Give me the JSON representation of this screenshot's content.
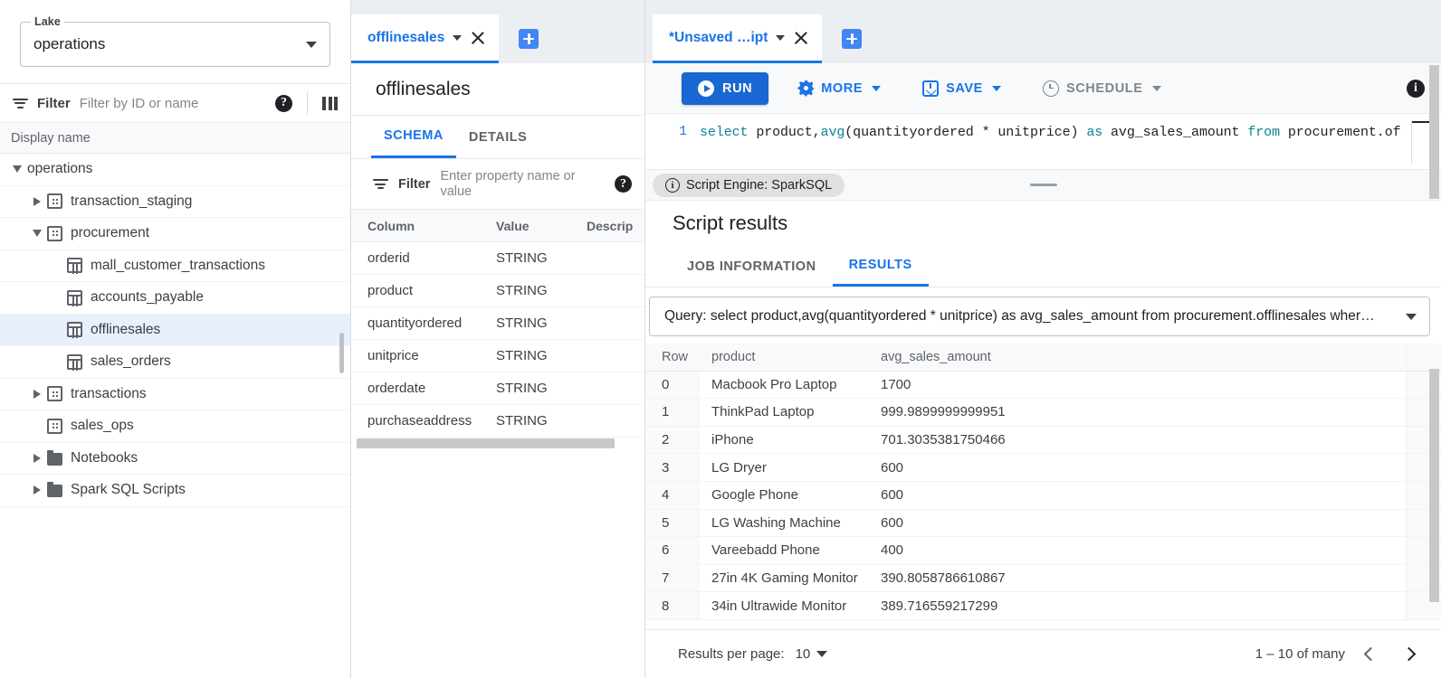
{
  "left_panel": {
    "lake_selector": {
      "legend": "Lake",
      "value": "operations",
      "icon": "chevron-down-icon"
    },
    "filter": {
      "label": "Filter",
      "placeholder": "Filter by ID or name",
      "help_icon": "help-icon",
      "columns_icon": "columns-icon"
    },
    "list_header": "Display name",
    "tree": [
      {
        "label": "operations",
        "depth": 0,
        "twisty": "open",
        "icon": "none",
        "selected": false
      },
      {
        "label": "transaction_staging",
        "depth": 1,
        "twisty": "closed",
        "icon": "database",
        "selected": false
      },
      {
        "label": "procurement",
        "depth": 1,
        "twisty": "open",
        "icon": "database",
        "selected": false
      },
      {
        "label": "mall_customer_transactions",
        "depth": 2,
        "twisty": "none",
        "icon": "table",
        "selected": false
      },
      {
        "label": "accounts_payable",
        "depth": 2,
        "twisty": "none",
        "icon": "table",
        "selected": false
      },
      {
        "label": "offlinesales",
        "depth": 2,
        "twisty": "none",
        "icon": "table",
        "selected": true
      },
      {
        "label": "sales_orders",
        "depth": 2,
        "twisty": "none",
        "icon": "table",
        "selected": false
      },
      {
        "label": "transactions",
        "depth": 1,
        "twisty": "closed",
        "icon": "database",
        "selected": false
      },
      {
        "label": "sales_ops",
        "depth": 1,
        "twisty": "none",
        "icon": "database",
        "selected": false
      },
      {
        "label": "Notebooks",
        "depth": 1,
        "twisty": "closed",
        "icon": "folder",
        "selected": false
      },
      {
        "label": "Spark SQL Scripts",
        "depth": 1,
        "twisty": "closed",
        "icon": "folder",
        "selected": false
      }
    ]
  },
  "mid_panel": {
    "tab": {
      "label": "offlinesales",
      "caret_icon": "chevron-down-icon",
      "close_icon": "close-icon"
    },
    "add_tab_icon": "plus-icon",
    "title": "offlinesales",
    "subtabs": [
      {
        "label": "SCHEMA",
        "active": true
      },
      {
        "label": "DETAILS",
        "active": false
      }
    ],
    "property_filter": {
      "label": "Filter",
      "placeholder": "Enter property name or value",
      "help_icon": "help-icon"
    },
    "schema_columns": [
      "Column",
      "Value",
      "Descrip"
    ],
    "schema_rows": [
      {
        "column": "orderid",
        "value": "STRING",
        "description": ""
      },
      {
        "column": "product",
        "value": "STRING",
        "description": ""
      },
      {
        "column": "quantityordered",
        "value": "STRING",
        "description": ""
      },
      {
        "column": "unitprice",
        "value": "STRING",
        "description": ""
      },
      {
        "column": "orderdate",
        "value": "STRING",
        "description": ""
      },
      {
        "column": "purchaseaddress",
        "value": "STRING",
        "description": ""
      }
    ]
  },
  "right_panel": {
    "tab": {
      "label": "*Unsaved …ipt",
      "caret_icon": "chevron-down-icon",
      "close_icon": "close-icon"
    },
    "add_tab_icon": "plus-icon",
    "toolbar": {
      "run_label": "RUN",
      "more_label": "MORE",
      "save_label": "SAVE",
      "schedule_label": "SCHEDULE",
      "info_icon": "info-icon"
    },
    "editor": {
      "line_number": "1",
      "code_parts": [
        {
          "text": "select",
          "kind": "keyword"
        },
        {
          "text": " product,",
          "kind": "plain"
        },
        {
          "text": "avg",
          "kind": "keyword"
        },
        {
          "text": "(quantityordered * unitprice) ",
          "kind": "plain"
        },
        {
          "text": "as",
          "kind": "keyword"
        },
        {
          "text": " avg_sales_amount ",
          "kind": "plain"
        },
        {
          "text": "from",
          "kind": "keyword"
        },
        {
          "text": " procurement.of",
          "kind": "plain"
        }
      ]
    },
    "engine_chip": {
      "label": "Script Engine: SparkSQL",
      "icon": "info-icon"
    },
    "results_title": "Script results",
    "results_tabs": [
      {
        "label": "JOB INFORMATION",
        "active": false
      },
      {
        "label": "RESULTS",
        "active": true
      }
    ],
    "query_select": {
      "text": "Query: select product,avg(quantityordered * unitprice) as avg_sales_amount from procurement.offlinesales wher…",
      "caret_icon": "chevron-down-icon"
    },
    "results_table": {
      "headers": [
        "Row",
        "product",
        "avg_sales_amount"
      ],
      "rows": [
        {
          "row": "0",
          "product": "Macbook Pro Laptop",
          "avg_sales_amount": "1700"
        },
        {
          "row": "1",
          "product": "ThinkPad Laptop",
          "avg_sales_amount": "999.9899999999951"
        },
        {
          "row": "2",
          "product": "iPhone",
          "avg_sales_amount": "701.3035381750466"
        },
        {
          "row": "3",
          "product": "LG Dryer",
          "avg_sales_amount": "600"
        },
        {
          "row": "4",
          "product": "Google Phone",
          "avg_sales_amount": "600"
        },
        {
          "row": "5",
          "product": "LG Washing Machine",
          "avg_sales_amount": "600"
        },
        {
          "row": "6",
          "product": "Vareebadd Phone",
          "avg_sales_amount": "400"
        },
        {
          "row": "7",
          "product": "27in 4K Gaming Monitor",
          "avg_sales_amount": "390.8058786610867"
        },
        {
          "row": "8",
          "product": "34in Ultrawide Monitor",
          "avg_sales_amount": "389.716559217299"
        }
      ]
    },
    "footer": {
      "results_per_page_label": "Results per page:",
      "results_per_page_value": "10",
      "range": "1 – 10 of many",
      "prev_icon": "chevron-left-icon",
      "next_icon": "chevron-right-icon"
    }
  },
  "colors": {
    "accent_blue": "#1a73e8",
    "run_blue": "#1967d2",
    "selected_row": "#e8f0fe",
    "sql_keyword": "#0b8497"
  }
}
